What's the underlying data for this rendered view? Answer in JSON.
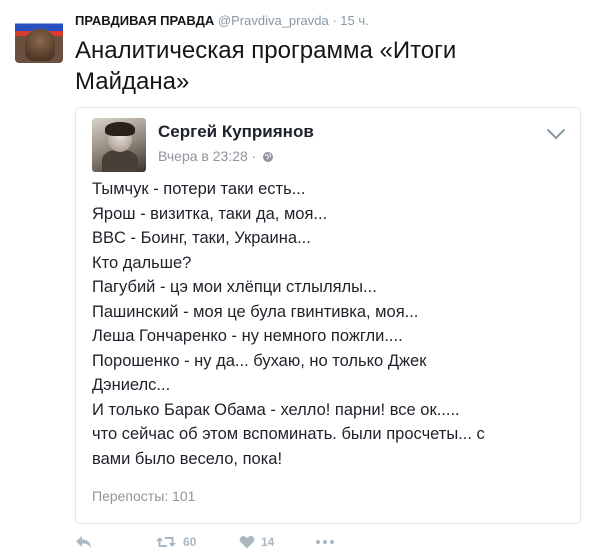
{
  "tweet": {
    "author_name": "ПРАВДИВАЯ ПРАВДА",
    "handle": "@Pravdiva_pravda",
    "separator": "·",
    "time": "15 ч.",
    "text": "Аналитическая программа «Итоги Майдана»"
  },
  "card": {
    "name": "Сергей Куприянов",
    "timestamp": "Вчера в 23:28",
    "meta_dot": "·",
    "lines": [
      "Тымчук - потери таки есть...",
      "Ярош - визитка, таки да, моя...",
      "BBC -  Боинг, таки, Украина...",
      "Кто дальше?",
      "Пагубий -  цэ мои хлёпци стлылялы...",
      "Пашинский -  моя це була гвинтивка, моя...",
      "Леша Гончаренко - ну немного пожгли....",
      "Порошенко - ну да... бухаю, но только Джек",
      "Дэниелс...",
      "И только Барак Обама - хелло! парни! все ок.....",
      "что сейчас об этом вспоминать. были просчеты... с",
      "вами было весело, пока!"
    ],
    "reposts": "Перепосты: 101"
  },
  "actions": {
    "retweets": "60",
    "likes": "14"
  },
  "colors": {
    "muted": "#8899a6",
    "icon": "#aab8c2",
    "fb_meta": "#90949c"
  },
  "icons": [
    "reply-icon",
    "retweet-icon",
    "like-icon",
    "more-icon",
    "globe-icon",
    "chevron-down-icon"
  ]
}
